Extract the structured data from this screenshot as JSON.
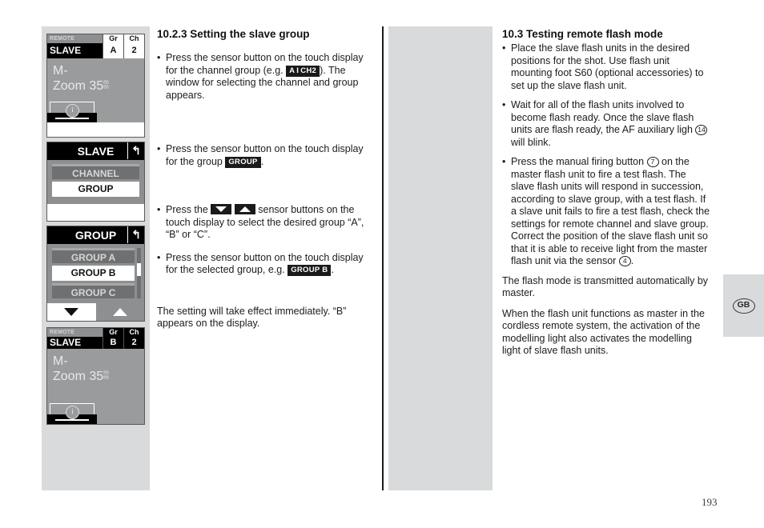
{
  "page": {
    "number": "193",
    "language_tab": "GB"
  },
  "lcd_panels": [
    {
      "id": "slave-status-group-a",
      "type": "status",
      "mode_small": "REMOTE",
      "mode_large": "SLAVE",
      "cells": [
        {
          "label": "Gr",
          "value": "A",
          "style": "light"
        },
        {
          "label": "Ch",
          "value": "2",
          "style": "light"
        }
      ],
      "body_line1": "M-",
      "body_line2": "Zoom 35",
      "body_unit": "mm",
      "info_icon": "i"
    },
    {
      "id": "slave-menu",
      "type": "menu",
      "title": "SLAVE",
      "back_icon": "↰",
      "items": [
        {
          "label": "CHANNEL",
          "state": "inactive"
        },
        {
          "label": "GROUP",
          "state": "selected"
        }
      ]
    },
    {
      "id": "group-menu",
      "type": "menu-scroll",
      "title": "GROUP",
      "back_icon": "↰",
      "items": [
        {
          "label": "GROUP A",
          "state": "inactive"
        },
        {
          "label": "GROUP B",
          "state": "selected"
        },
        {
          "label": "GROUP C",
          "state": "inactive"
        }
      ],
      "nav_down_icon": "triangle-down",
      "nav_up_icon": "triangle-up"
    },
    {
      "id": "slave-status-group-b",
      "type": "status",
      "mode_small": "REMOTE",
      "mode_large": "SLAVE",
      "cells": [
        {
          "label": "Gr",
          "value": "B",
          "style": "dark"
        },
        {
          "label": "Ch",
          "value": "2",
          "style": "dark"
        }
      ],
      "body_line1": "M-",
      "body_line2": "Zoom 35",
      "body_unit": "mm",
      "info_icon": "i"
    }
  ],
  "middle_column": {
    "heading": "10.2.3 Setting the slave group",
    "bullets": [
      {
        "parts": [
          {
            "t": "text",
            "v": "Press the sensor button on the touch display for the channel group (e.g. "
          },
          {
            "t": "badge",
            "v": "A I CH2",
            "badge_left": "A",
            "badge_sep": "I",
            "badge_right": "CH2"
          },
          {
            "t": "text",
            "v": "). The window for selecting the channel and group appears."
          }
        ]
      },
      {
        "parts": [
          {
            "t": "text",
            "v": "Press the sensor button on the touch display for the group "
          },
          {
            "t": "badge",
            "v": "GROUP"
          },
          {
            "t": "text",
            "v": "."
          }
        ]
      },
      {
        "parts": [
          {
            "t": "text",
            "v": "Press the "
          },
          {
            "t": "badge-tri-down",
            "v": "▼"
          },
          {
            "t": "badge-tri-up",
            "v": "▲"
          },
          {
            "t": "text",
            "v": " sensor buttons on the touch display to select the desired group “A”, “B” or “C”."
          }
        ]
      },
      {
        "parts": [
          {
            "t": "text",
            "v": "Press the sensor button on the touch display for the selected group, e.g. "
          },
          {
            "t": "badge",
            "v": "GROUP B"
          },
          {
            "t": "text",
            "v": "."
          }
        ]
      }
    ],
    "closing_paragraph": "The setting will take effect immediately. “B” appears on the display."
  },
  "right_column": {
    "heading": "10.3 Testing remote flash mode",
    "bullets": [
      {
        "text": "Place the slave flash units in the desired positions for the shot. Use flash unit mounting foot S60 (optional accessories) to set up the slave flash unit."
      },
      {
        "text_before": "Wait for all of the flash units involved to become flash ready. Once the slave flash units are flash ready, the AF auxiliary ligh ",
        "circled": "14",
        "text_after": " will blink."
      },
      {
        "text_before": "Press the manual firing button ",
        "circled": "7",
        "text_mid": " on the master flash unit to fire a test flash. The slave flash units will respond in succession, according to slave group, with a test flash. If a slave unit fails to fire a test flash, check the settings for remote channel and slave group. Correct the position of the slave flash unit so that it is able to receive light from the master flash unit via the sensor ",
        "circled2": "4",
        "text_after": "."
      }
    ],
    "paragraphs": [
      "The flash mode is transmitted automatically by master.",
      "When the flash unit functions as master in the cordless remote system, the activation of the modelling light also activates the modelling light of slave flash units."
    ]
  },
  "colors": {
    "page_background": "#ffffff",
    "column_grey": "#d9dadb",
    "lcd_body_grey": "#9a9b9c",
    "lcd_menu_grey": "#8e8f90",
    "lcd_item_inactive": "#6f7071",
    "lcd_black": "#000000",
    "divider": "#1b1b1b",
    "text": "#1c1c1c"
  }
}
